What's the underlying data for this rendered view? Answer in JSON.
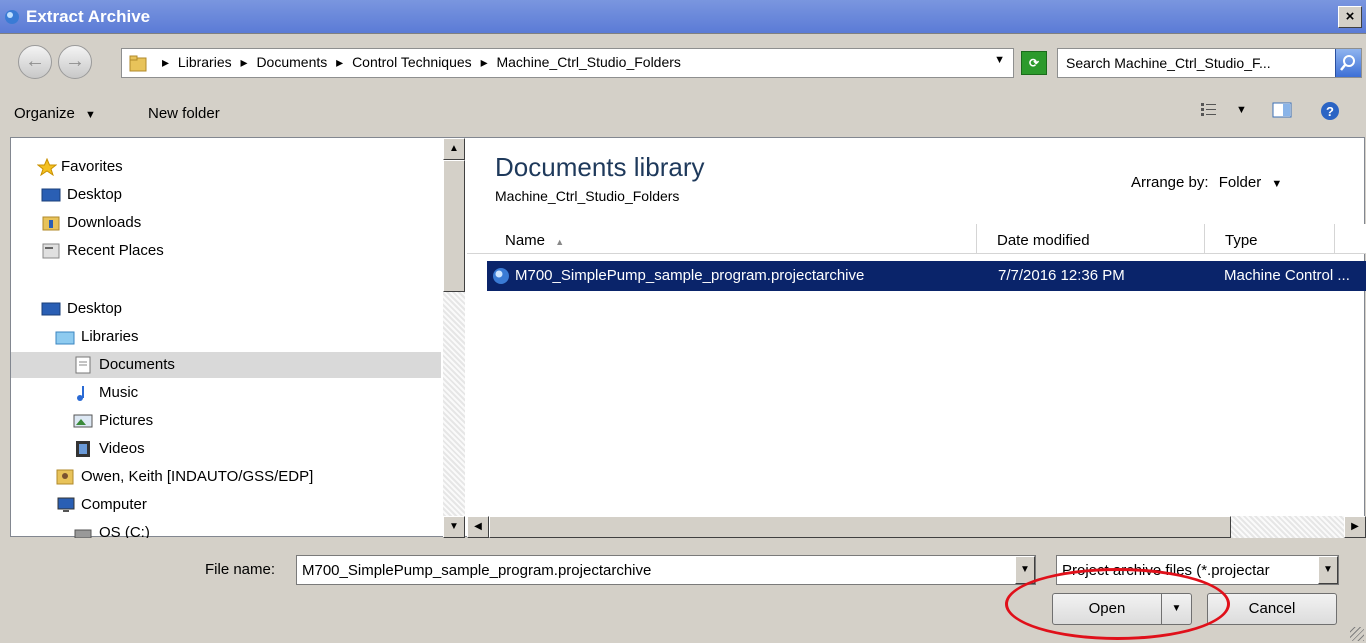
{
  "window": {
    "title": "Extract Archive",
    "close_label": "×"
  },
  "address": {
    "breadcrumbs": [
      "Libraries",
      "Documents",
      "Control Techniques",
      "Machine_Ctrl_Studio_Folders"
    ],
    "breadcrumb_sep": "▸",
    "search_placeholder": "Search Machine_Ctrl_Studio_F..."
  },
  "toolbar": {
    "organize_label": "Organize",
    "new_folder_label": "New folder"
  },
  "nav": {
    "items": [
      {
        "label": "Favorites",
        "icon": "star-icon"
      },
      {
        "label": "Desktop",
        "icon": "desktop-icon"
      },
      {
        "label": "Downloads",
        "icon": "downloads-icon"
      },
      {
        "label": "Recent Places",
        "icon": "recent-places-icon"
      },
      {
        "label": "Desktop",
        "icon": "desktop-icon"
      },
      {
        "label": "Libraries",
        "icon": "libraries-icon"
      },
      {
        "label": "Documents",
        "icon": "documents-icon",
        "selected": true
      },
      {
        "label": "Music",
        "icon": "music-icon"
      },
      {
        "label": "Pictures",
        "icon": "pictures-icon"
      },
      {
        "label": "Videos",
        "icon": "videos-icon"
      },
      {
        "label": "Owen, Keith [INDAUTO/GSS/EDP]",
        "icon": "user-icon"
      },
      {
        "label": "Computer",
        "icon": "computer-icon"
      },
      {
        "label": "OS (C:)",
        "icon": "drive-icon"
      }
    ]
  },
  "library": {
    "title": "Documents library",
    "subtitle": "Machine_Ctrl_Studio_Folders",
    "arrange_label": "Arrange by:",
    "arrange_value": "Folder"
  },
  "columns": {
    "name": "Name",
    "date_modified": "Date modified",
    "type": "Type"
  },
  "files": [
    {
      "name": "M700_SimplePump_sample_program.projectarchive",
      "date_modified": "7/7/2016 12:36 PM",
      "type": "Machine Control ..."
    }
  ],
  "footer": {
    "file_name_label": "File name:",
    "file_name_value": "M700_SimplePump_sample_program.projectarchive",
    "file_type_value": "Project archive files (*.projectar",
    "open_label": "Open",
    "cancel_label": "Cancel"
  },
  "colors": {
    "selection": "#0a246a",
    "highlight_circle": "#e0101a",
    "title_bar": "#6b8bd9"
  }
}
